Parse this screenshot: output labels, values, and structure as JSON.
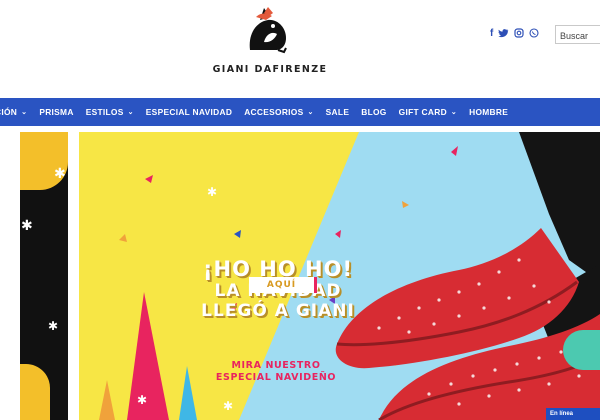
{
  "header": {
    "brand": "GIANI DAFIRENZE",
    "social": [
      "facebook-icon",
      "twitter-icon",
      "instagram-icon",
      "whatsapp-icon"
    ],
    "social_glyphs": [
      "f",
      "🐦",
      "◎",
      "✆"
    ],
    "search_placeholder": "Buscar"
  },
  "nav": {
    "items": [
      {
        "label": "CIÓN",
        "dropdown": true
      },
      {
        "label": "PRISMA",
        "dropdown": false
      },
      {
        "label": "ESTILOS",
        "dropdown": true
      },
      {
        "label": "ESPECIAL NAVIDAD",
        "dropdown": false
      },
      {
        "label": "ACCESORIOS",
        "dropdown": true
      },
      {
        "label": "SALE",
        "dropdown": false
      },
      {
        "label": "BLOG",
        "dropdown": false
      },
      {
        "label": "GIFT CARD",
        "dropdown": true
      },
      {
        "label": "HOMBRE",
        "dropdown": false
      }
    ],
    "chevron": "⌄"
  },
  "hero": {
    "headline_line1": "¡HO HO HO!",
    "headline_line2": "LA NAVIDAD",
    "headline_line3": "LLEGÓ A GIANI",
    "subline1": "MIRA NUESTRO",
    "subline2": "ESPECIAL NAVIDEÑO",
    "cta_label": "AQUÍ",
    "help_tab": "En línea"
  },
  "colors": {
    "nav_bg": "#2a54c2",
    "accent_pink": "#e8245f",
    "gold": "#d89a22",
    "yellow": "#f7e645",
    "sky": "#9fdcf2"
  }
}
